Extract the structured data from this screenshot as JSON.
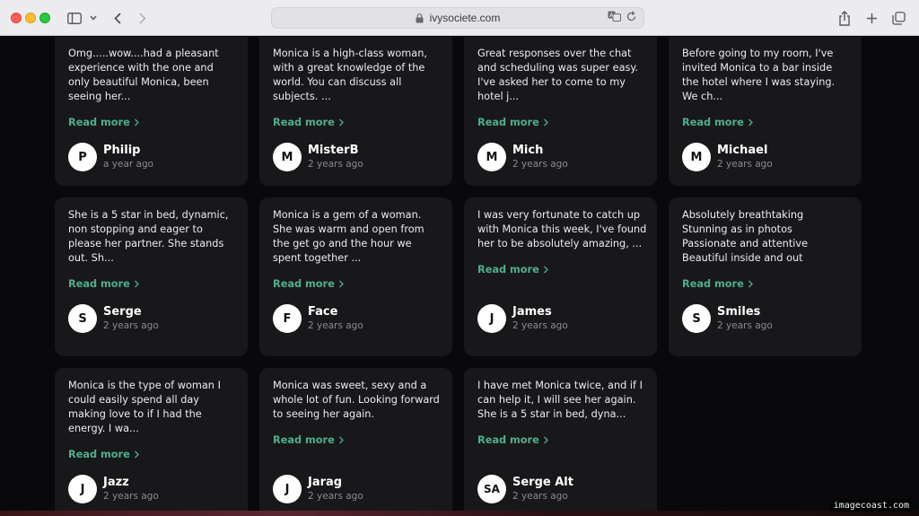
{
  "browser": {
    "url": "ivysociete.com",
    "icons": [
      "sidebar-icon",
      "chevron-down-icon",
      "back-icon",
      "forward-icon",
      "lock-icon",
      "translate-icon",
      "reload-icon",
      "share-icon",
      "plus-icon",
      "tabs-icon"
    ]
  },
  "reviews": [
    {
      "text": "Omg.....wow....had a pleasant\nexperience with the one and\nonly beautiful Monica, been\nseeing her...",
      "read_more": "Read more",
      "initial": "P",
      "name": "Philip",
      "time": "a year ago"
    },
    {
      "text": "Monica is a high-class woman,\nwith a great knowledge of the\nworld. You can discuss all\nsubjects. ...",
      "read_more": "Read more",
      "initial": "M",
      "name": "MisterB",
      "time": "2 years ago"
    },
    {
      "text": "Great responses over the chat\nand scheduling was super easy.\nI've asked her to come to my\nhotel j...",
      "read_more": "Read more",
      "initial": "M",
      "name": "Mich",
      "time": "2 years ago"
    },
    {
      "text": "Before going to my room, I've\ninvited Monica to a bar inside\nthe hotel where I was staying.\nWe ch...",
      "read_more": "Read more",
      "initial": "M",
      "name": "Michael",
      "time": "2 years ago"
    },
    {
      "text": "She is a 5 star in bed, dynamic,\nnon stopping and eager to\nplease her partner. She stands\nout. Sh...",
      "read_more": "Read more",
      "initial": "S",
      "name": "Serge",
      "time": "2 years ago"
    },
    {
      "text": "Monica is a gem of a woman.\nShe was warm and open from\nthe get go and the hour we\nspent together ...",
      "read_more": "Read more",
      "initial": "F",
      "name": "Face",
      "time": "2 years ago"
    },
    {
      "text": "I was very fortunate to catch up\nwith Monica this week, I've found\nher to be absolutely amazing, ...",
      "read_more": "Read more",
      "initial": "J",
      "name": "James",
      "time": "2 years ago"
    },
    {
      "text": "Absolutely breathtaking\nStunning as in photos\nPassionate and attentive\nBeautiful inside and out",
      "read_more": "Read more",
      "initial": "S",
      "name": "Smiles",
      "time": "2 years ago"
    },
    {
      "text": "Monica is the type of woman I\ncould easily spend all day\nmaking love to if I had the\nenergy. I wa...",
      "read_more": "Read more",
      "initial": "J",
      "name": "Jazz",
      "time": "2 years ago"
    },
    {
      "text": "Monica was sweet, sexy and a\nwhole lot of fun. Looking forward\nto seeing her again.",
      "read_more": "Read more",
      "initial": "J",
      "name": "Jarag",
      "time": "2 years ago"
    },
    {
      "text": "I have met Monica twice, and if I\ncan help it, I will see her again.\nShe is a 5 star in bed, dyna...",
      "read_more": "Read more",
      "initial": "SA",
      "name": "Serge Alt",
      "time": "2 years ago"
    }
  ],
  "watermark": "imagecoast.com",
  "colors": {
    "card_bg": "#18181b",
    "page_bg": "#09090b",
    "accent": "#4fae8c"
  }
}
